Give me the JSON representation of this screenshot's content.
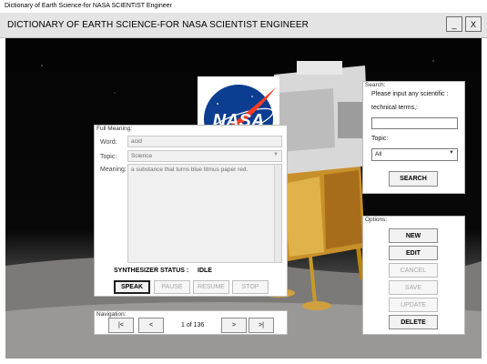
{
  "window": {
    "title": "Dictionary of Earth Science-for NASA SCIENTIST Engineer",
    "minimize_label": "_",
    "close_label": "X"
  },
  "app": {
    "header_title": "DICTIONARY OF EARTH SCIENCE-FOR NASA SCIENTIST ENGINEER"
  },
  "logo": {
    "text": "NASA",
    "icon": "nasa-meatball-logo"
  },
  "full_meaning": {
    "legend": "Full Meaning:",
    "word_label": "Word:",
    "word_value": "acid",
    "topic_label": "Topic:",
    "topic_value": "Science",
    "meaning_label": "Meaning:",
    "meaning_value": "a substance that turns blue litmus paper red.",
    "status_label": "SYNTHESIZER  STATUS  :",
    "status_value": "IDLE",
    "buttons": {
      "speak": "SPEAK",
      "pause": "PAUSE",
      "resume": "RESUME",
      "stop": "STOP"
    }
  },
  "search": {
    "legend": "Search:",
    "prompt_line1": "Please input any scientific :",
    "prompt_line2": "technical terms,:",
    "input_value": "",
    "topic_label": "Topic:",
    "topic_value": "All",
    "search_button": "SEARCH"
  },
  "options": {
    "legend": "Options:",
    "new": "NEW",
    "edit": "EDIT",
    "cancel": "CANCEL",
    "save": "SAVE",
    "update": "UPDATE",
    "delete": "DELETE"
  },
  "navigation": {
    "legend": "Navigation:",
    "first": "|<",
    "prev": "<",
    "position": "1 of 136",
    "next": ">",
    "last": ">|"
  },
  "colors": {
    "nasa_blue": "#0b3d91",
    "nasa_red": "#fc3d21"
  }
}
